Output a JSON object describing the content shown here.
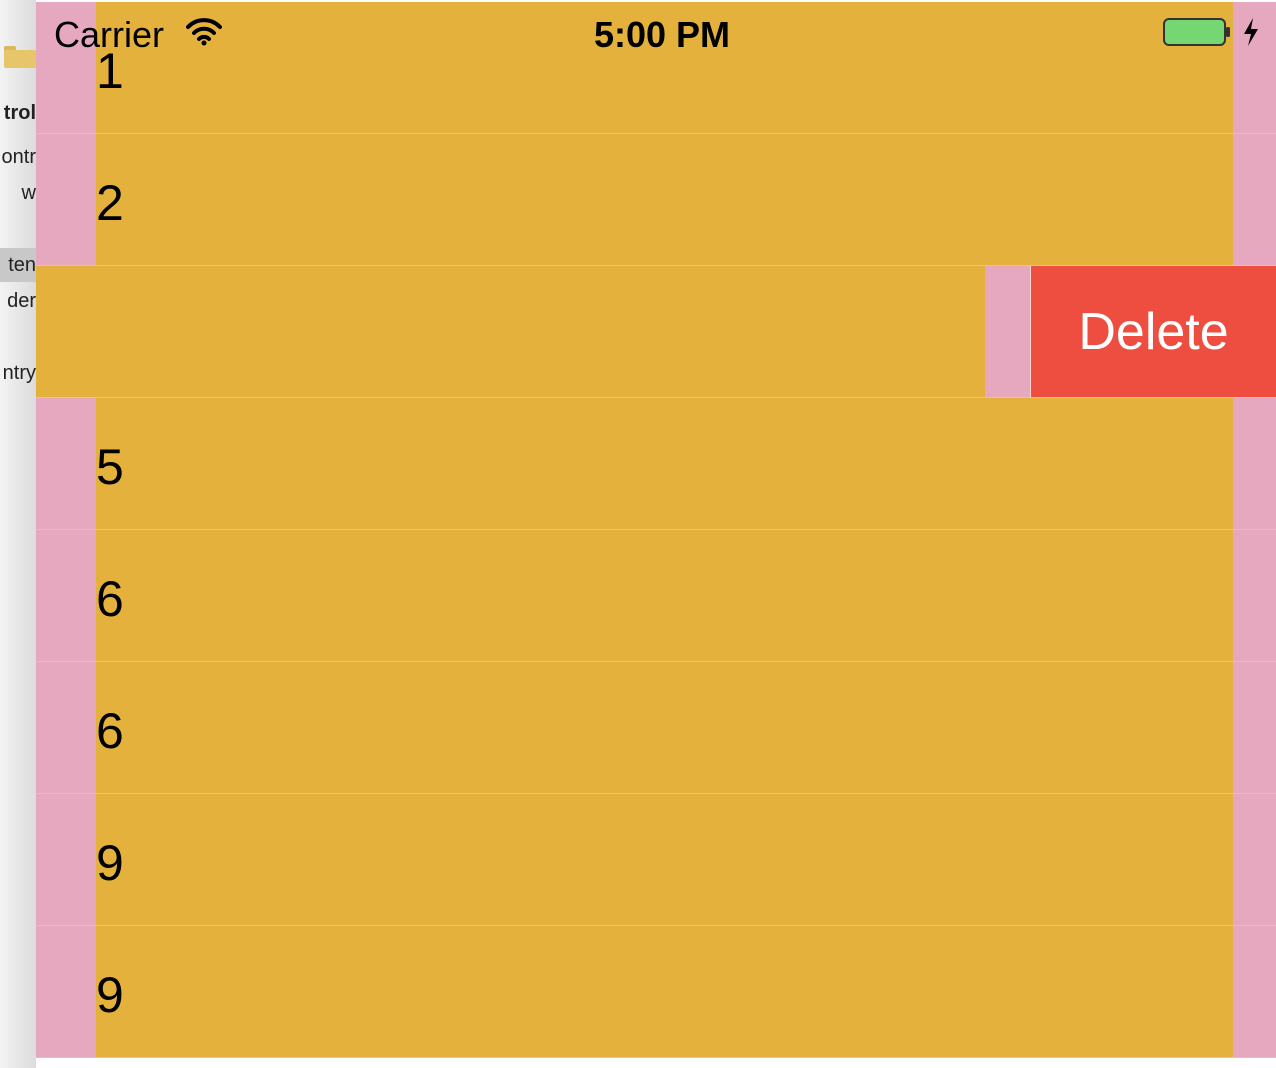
{
  "background_sidebar": {
    "fragments": [
      "trol",
      "ontr",
      "w",
      "ten",
      "der",
      "ntry"
    ]
  },
  "status_bar": {
    "carrier": "Carrier",
    "time": "5:00 PM"
  },
  "table": {
    "rows": [
      {
        "label": "1"
      },
      {
        "label": "2"
      },
      {
        "label": "",
        "swiped": true
      },
      {
        "label": "5"
      },
      {
        "label": "6"
      },
      {
        "label": "6"
      },
      {
        "label": "9"
      },
      {
        "label": "9"
      }
    ],
    "delete_label": "Delete"
  },
  "colors": {
    "cell_background": "#e4b13d",
    "cell_inset": "#e5a8bf",
    "delete_action": "#ee4e3f",
    "battery_fill": "#76d672"
  }
}
